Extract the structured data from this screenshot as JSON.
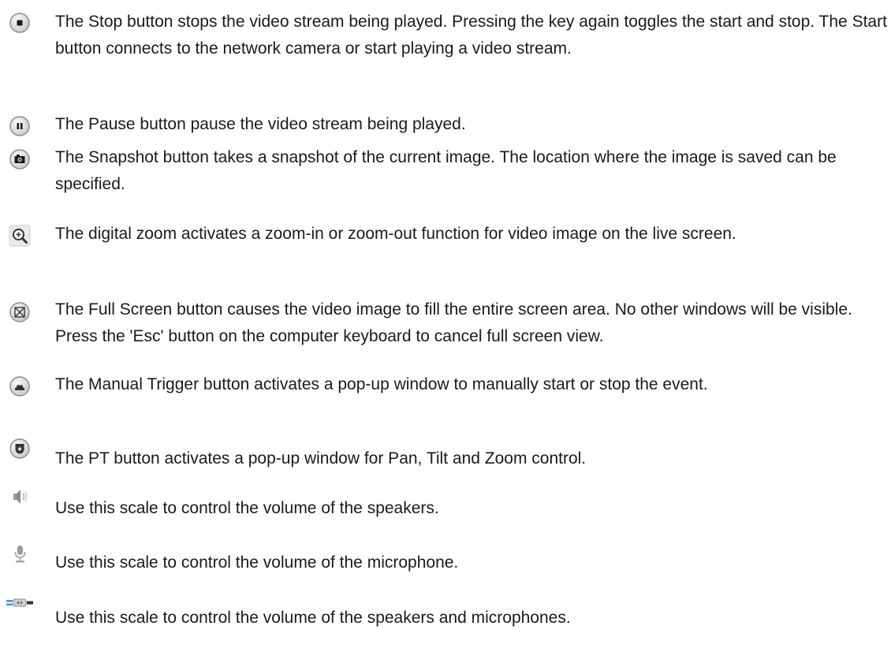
{
  "items": [
    {
      "icon": "stop-icon",
      "text": "The Stop button stops the video stream being played. Pressing the key again toggles the start and stop. The Start button connects to the network camera or start playing a video stream."
    },
    {
      "icon": "pause-icon",
      "text": "The Pause button pause the video stream being played."
    },
    {
      "icon": "snapshot-icon",
      "text": "The Snapshot button takes a snapshot of the current image. The location where the image is saved can be specified."
    },
    {
      "icon": "zoom-icon",
      "text": "The digital zoom activates a zoom-in or zoom-out function for video image on the live screen."
    },
    {
      "icon": "fullscreen-icon",
      "text": "The Full Screen button causes the video image to fill the entire screen area. No other windows will be visible. Press the 'Esc' button on the computer keyboard to cancel full screen view."
    },
    {
      "icon": "manual-trigger-icon",
      "text": "The Manual Trigger button activates a pop-up window to manually start or stop the event."
    },
    {
      "icon": "pt-icon",
      "text": "The PT button activates a pop-up window for Pan, Tilt and Zoom control."
    },
    {
      "icon": "speaker-icon",
      "text": "Use this scale to control the volume of the speakers."
    },
    {
      "icon": "microphone-icon",
      "text": "Use this scale to control the volume of the microphone."
    },
    {
      "icon": "volume-slider-icon",
      "text": "Use this scale to control the volume of the speakers and microphones."
    }
  ]
}
